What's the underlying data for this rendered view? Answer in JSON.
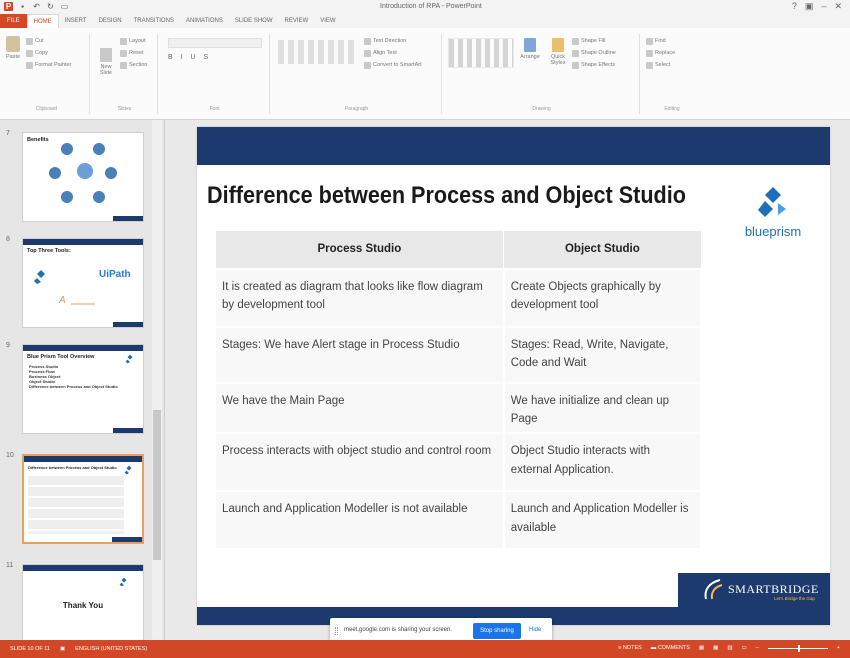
{
  "window": {
    "title": "Introduction of RPA - PowerPoint",
    "controls": [
      "?",
      "▣",
      "–",
      "✕"
    ]
  },
  "ribbon_tabs": [
    "FILE",
    "HOME",
    "INSERT",
    "DESIGN",
    "TRANSITIONS",
    "ANIMATIONS",
    "SLIDE SHOW",
    "REVIEW",
    "VIEW"
  ],
  "ribbon": {
    "clipboard": {
      "paste": "Paste",
      "cut": "Cut",
      "copy": "Copy",
      "format_painter": "Format Painter",
      "label": "Clipboard"
    },
    "slides": {
      "new_slide": "New Slide",
      "layout": "Layout",
      "reset": "Reset",
      "section": "Section",
      "label": "Slides"
    },
    "font": {
      "label": "Font"
    },
    "paragraph": {
      "text_direction": "Text Direction",
      "align_text": "Align Text",
      "smartart": "Convert to SmartArt",
      "label": "Paragraph"
    },
    "drawing": {
      "arrange": "Arrange",
      "quick_styles": "Quick Styles",
      "shape_fill": "Shape Fill",
      "shape_outline": "Shape Outline",
      "shape_effects": "Shape Effects",
      "label": "Drawing"
    },
    "editing": {
      "find": "Find",
      "replace": "Replace",
      "select": "Select",
      "label": "Editing"
    }
  },
  "thumbnails": [
    {
      "num": "7",
      "title": "Benefits"
    },
    {
      "num": "8",
      "title": "Top Three Tools:",
      "logo_text": "UiPath"
    },
    {
      "num": "9",
      "title": "Blue Prism Tool Overview",
      "bullets": [
        "Process Studio",
        "Process Flow",
        "Business Object",
        "Object Studio",
        "Difference between Process and Object Studio"
      ]
    },
    {
      "num": "10",
      "title": "Difference between Process and Object Studio"
    },
    {
      "num": "11",
      "title": "Thank You"
    }
  ],
  "slide": {
    "title": "Difference between Process and Object Studio",
    "logo_text": "blueprism",
    "columns": [
      "Process Studio",
      "Object Studio"
    ],
    "rows": [
      [
        "It is created as diagram that looks like flow diagram by development tool",
        "Create Objects graphically by development tool"
      ],
      [
        "Stages: We have Alert stage in Process Studio",
        "Stages: Read, Write, Navigate, Code and Wait"
      ],
      [
        "We have the Main Page",
        "We have initialize and clean up Page"
      ],
      [
        "Process interacts with object studio and control room",
        "Object Studio interacts with external Application."
      ],
      [
        "Launch and Application Modeller is not available",
        "Launch and Application Modeller is available"
      ]
    ],
    "footer_logo": "SMARTBRIDGE",
    "footer_tagline": "Let's Bridge the Gap"
  },
  "sharing": {
    "message": "meet.google.com is sharing your screen.",
    "stop": "Stop sharing",
    "hide": "Hide"
  },
  "status": {
    "slide": "SLIDE 10 OF 11",
    "language": "ENGLISH (UNITED STATES)",
    "notes": "NOTES",
    "comments": "COMMENTS"
  },
  "colors": {
    "accent": "#d24726",
    "slide_navy": "#1c3a6e",
    "google_blue": "#1a73e8"
  }
}
